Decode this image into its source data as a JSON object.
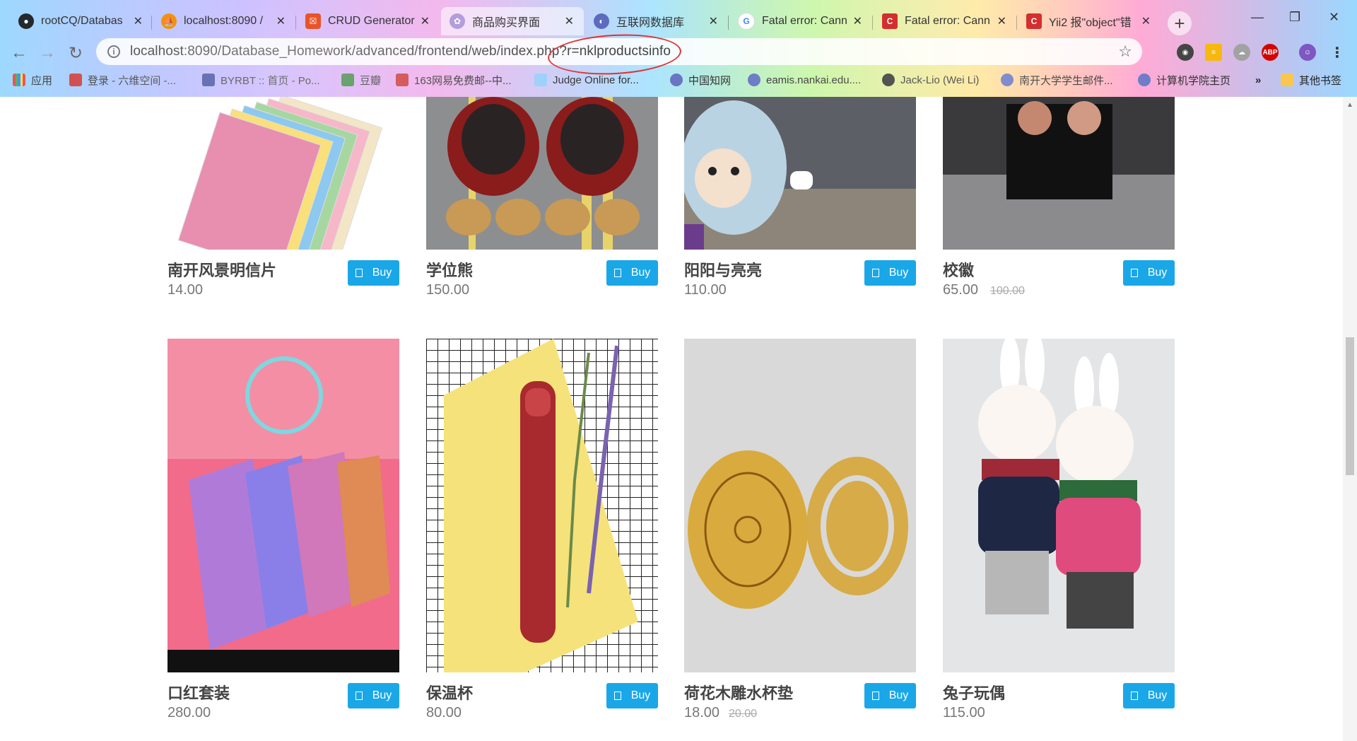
{
  "browser": {
    "tabs": [
      {
        "title": "rootCQ/Databas",
        "color": "#24292e"
      },
      {
        "title": "localhost:8090 /",
        "color": "#f29111"
      },
      {
        "title": "CRUD Generator",
        "color": "#e8542a"
      },
      {
        "title": "商品购买界面",
        "color": "#b39ddb"
      },
      {
        "title": "互联网数据库",
        "color": "#5c6bc0"
      },
      {
        "title": "Fatal error: Cann",
        "color": "#4285f4"
      },
      {
        "title": "Fatal error: Cann",
        "color": "#d32f2f"
      },
      {
        "title": "Yii2 报\"object\"错",
        "color": "#d32f2f"
      }
    ],
    "url_host": "localhost",
    "url_rest": ":8090/Database_Homework/advanced/frontend/web/index.php?r=nklproductsinfo",
    "bookmarks": [
      {
        "label": "应用",
        "color": "#e53935"
      },
      {
        "label": "登录 - 六维空间 -...",
        "color": "#c62828"
      },
      {
        "label": "BYRBT :: 首页 - Po...",
        "color": "#283593"
      },
      {
        "label": "豆瓣",
        "color": "#2e7d32"
      },
      {
        "label": "163网易免费邮--中...",
        "color": "#c62828"
      },
      {
        "label": "Judge Online for...",
        "color": "#90caf9"
      },
      {
        "label": "中国知网",
        "color": "#5c6bc0"
      },
      {
        "label": "eamis.nankai.edu....",
        "color": "#5c6bc0"
      },
      {
        "label": "Jack-Lio (Wei Li)",
        "color": "#222222"
      },
      {
        "label": "南开大学学生邮件...",
        "color": "#5c6bc0"
      },
      {
        "label": "计算机学院主页",
        "color": "#5c6bc0"
      },
      {
        "label": "»",
        "color": ""
      },
      {
        "label": "其他书签",
        "color": "#f9c74f"
      }
    ]
  },
  "buy_label": "Buy",
  "products": [
    {
      "name": "南开风景明信片",
      "price": "14.00",
      "old_price": "",
      "image": "postcards"
    },
    {
      "name": "学位熊",
      "price": "150.00",
      "old_price": "",
      "image": "graduation-bears"
    },
    {
      "name": "阳阳与亮亮",
      "price": "110.00",
      "old_price": "",
      "image": "mascot-figure"
    },
    {
      "name": "校徽",
      "price": "65.00",
      "old_price": "100.00",
      "image": "school-badges"
    },
    {
      "name": "口红套装",
      "price": "280.00",
      "old_price": "",
      "image": "lipstick-set"
    },
    {
      "name": "保温杯",
      "price": "80.00",
      "old_price": "",
      "image": "thermos-cup"
    },
    {
      "name": "荷花木雕水杯垫",
      "price": "18.00",
      "old_price": "20.00",
      "image": "wood-coasters"
    },
    {
      "name": "兔子玩偶",
      "price": "115.00",
      "old_price": "",
      "image": "rabbit-dolls"
    }
  ]
}
